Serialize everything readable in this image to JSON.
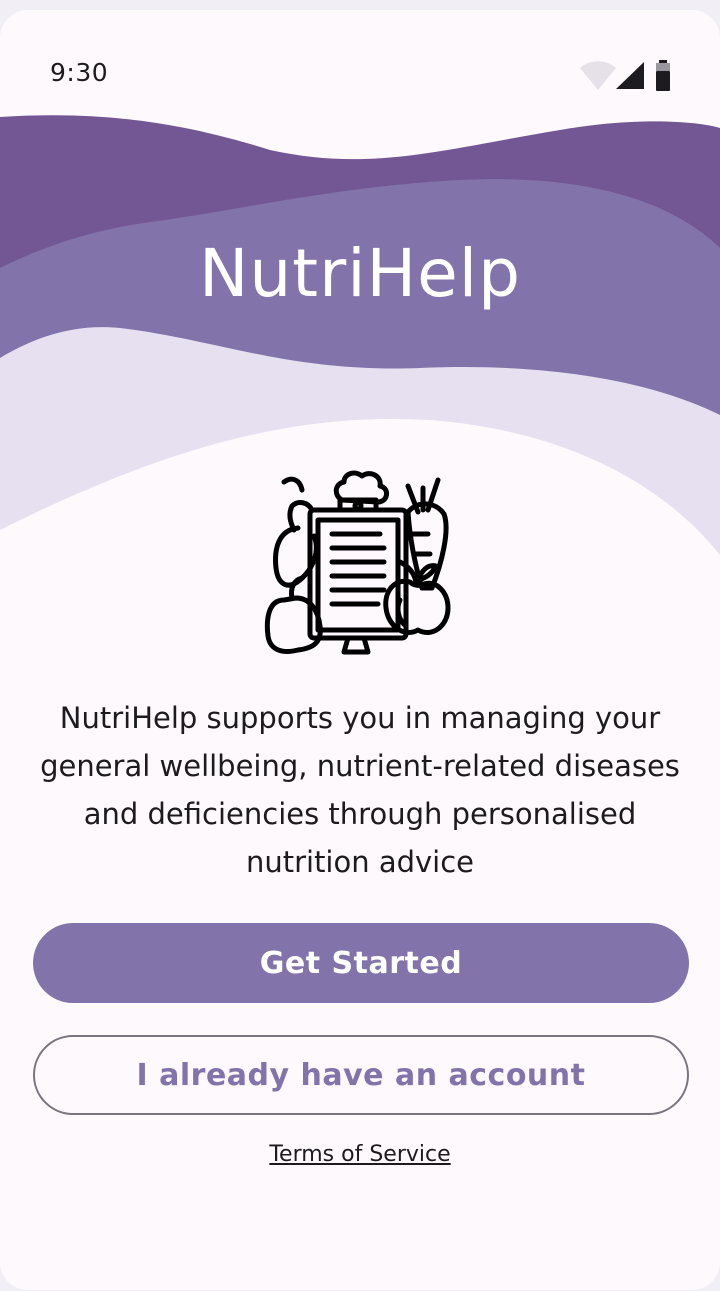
{
  "status_bar": {
    "time": "9:30",
    "icons": [
      "wifi-icon",
      "signal-icon",
      "battery-icon"
    ]
  },
  "app": {
    "title": "NutriHelp",
    "hero_icon": "clipboard-vegetables-icon",
    "description": "NutriHelp supports you in managing your general wellbeing, nutrient-related diseases and deficiencies through personalised nutrition advice"
  },
  "actions": {
    "get_started_label": "Get Started",
    "existing_account_label": "I already have an account",
    "terms_label": "Terms of Service"
  },
  "colors": {
    "wave_dark": "#735794",
    "wave_mid": "#8273aa",
    "wave_light": "#e6e0f0",
    "background": "#fdf9fd",
    "primary": "#8273aa",
    "outline": "#79747e",
    "text": "#1d1b20"
  }
}
